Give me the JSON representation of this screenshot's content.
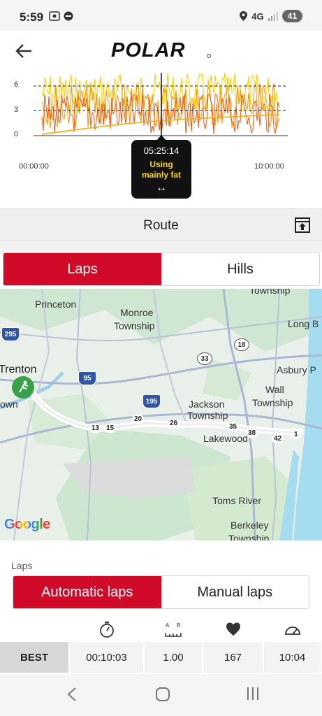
{
  "status_bar": {
    "time": "5:59",
    "network": "4G",
    "battery": "41"
  },
  "header": {
    "brand": "POLAR",
    "brand_color": "#111111",
    "accent_color": "#d10a2a",
    "back_icon": "arrow-left-icon"
  },
  "hr_chart": {
    "y_ticks": [
      "6",
      "3",
      "0"
    ],
    "x_start": "00:00:00",
    "x_end": "10:00:00",
    "popover": {
      "time": "05:25:14",
      "status_line1": "Using",
      "status_line2": "mainly fat",
      "arrows": "↔"
    }
  },
  "route": {
    "title": "Route",
    "action_icon": "export-icon"
  },
  "map_tabs": {
    "laps": "Laps",
    "hills": "Hills"
  },
  "map": {
    "places": {
      "princeton": "Princeton",
      "monroe_1": "Monroe",
      "monroe_2": "Township",
      "trenton": "Trenton",
      "town_partial": "own",
      "long_branch": "Long B",
      "asbury": "Asbury P",
      "wall_1": "Wall",
      "wall_2": "Township",
      "jackson_1": "Jackson",
      "jackson_2": "Township",
      "lakewood": "Lakewood",
      "toms_river": "Toms River",
      "berkeley_1": "Berkeley",
      "berkeley_2": "Township",
      "township_top": "Township"
    },
    "shields": {
      "i295": "295",
      "i95": "95",
      "i195": "195",
      "r18": "18",
      "r33": "33"
    },
    "lap_markers": [
      "1",
      "13",
      "15",
      "20",
      "26",
      "35",
      "38",
      "42"
    ],
    "attribution": "Google"
  },
  "laps": {
    "heading": "Laps",
    "automatic": "Automatic laps",
    "manual": "Manual laps",
    "column_icons": [
      "stopwatch-icon",
      "distance-icon",
      "heart-icon",
      "speedometer-icon"
    ],
    "best": {
      "label": "BEST",
      "duration": "00:10:03",
      "distance": "1.00",
      "heart_rate": "167",
      "pace": "10:04"
    }
  }
}
